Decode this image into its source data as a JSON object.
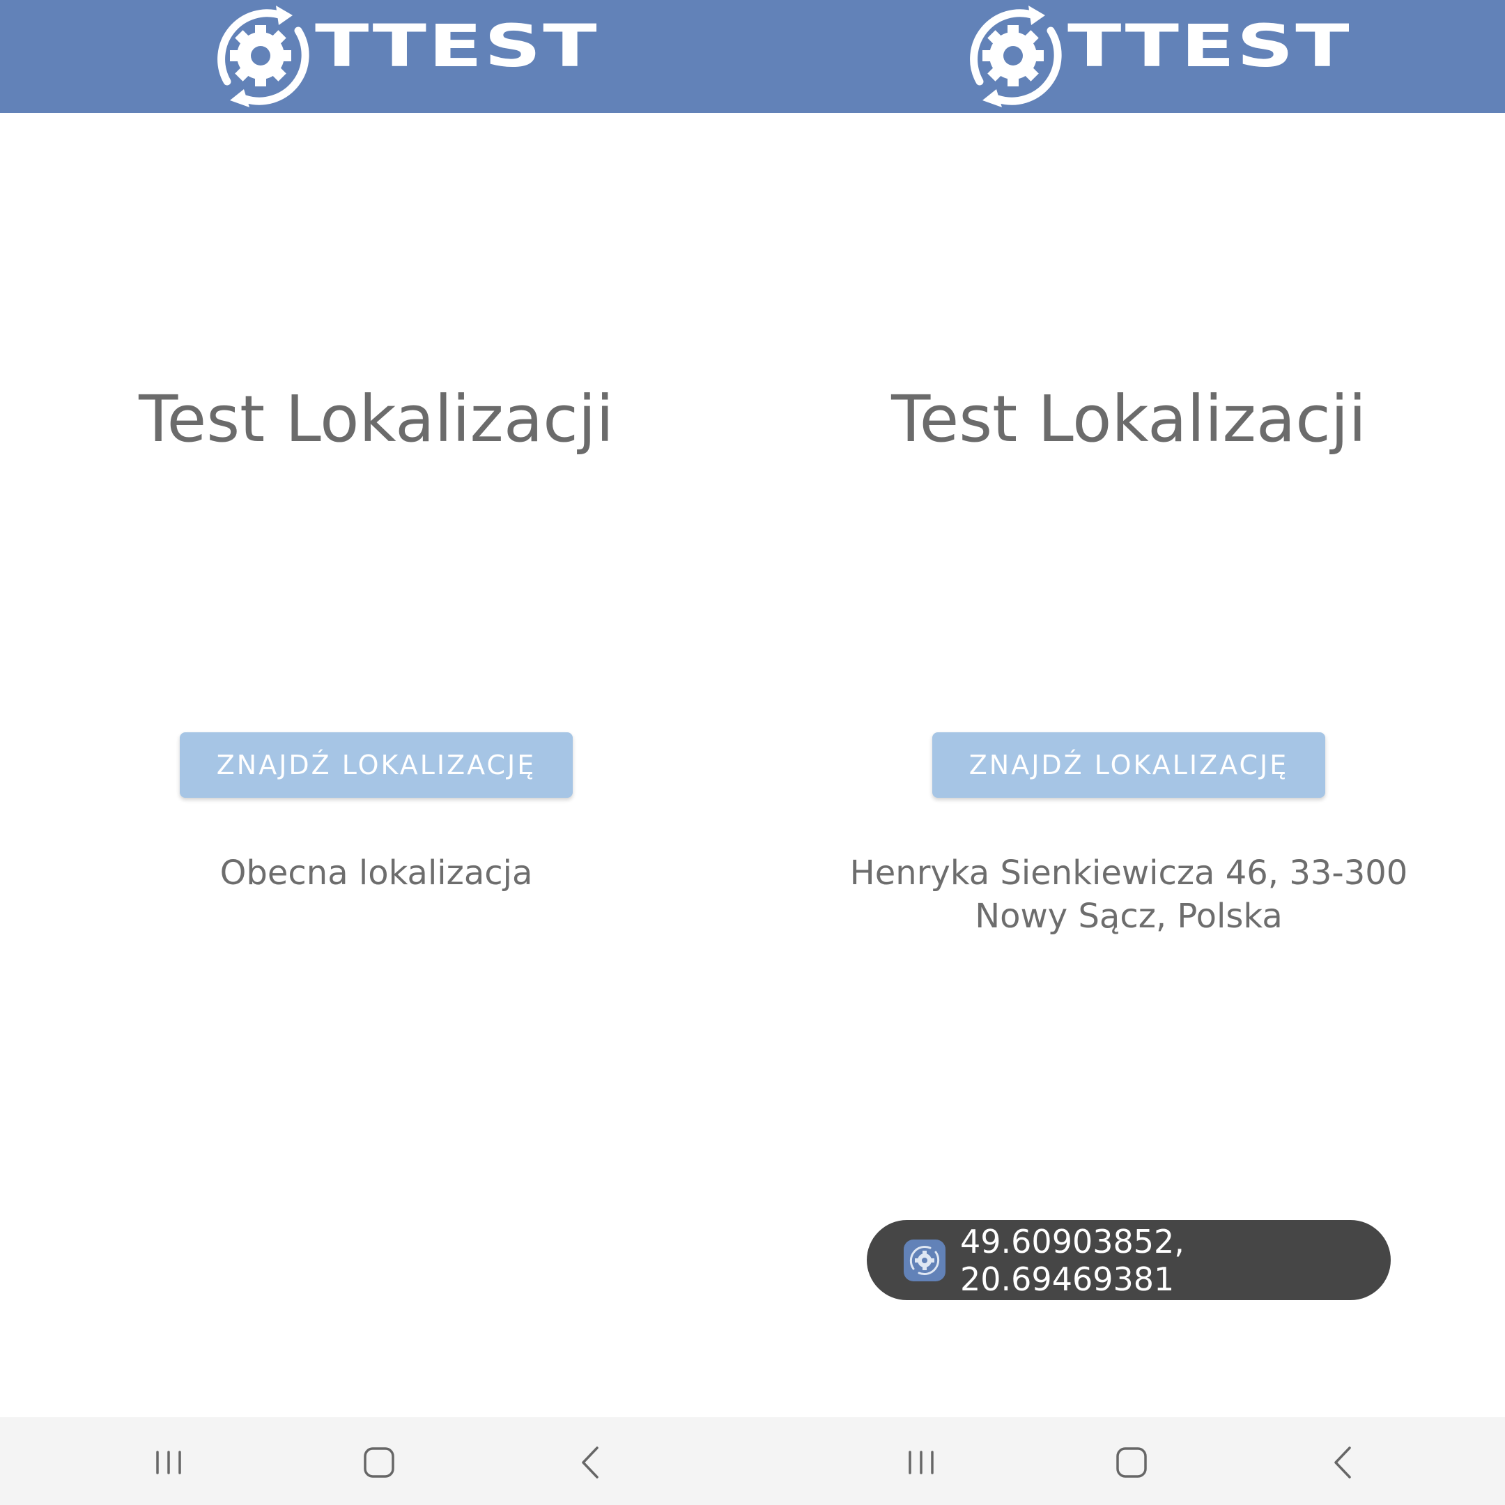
{
  "screens": [
    {
      "brand": {
        "logo_text": "TTEST",
        "icon": "gear-cycle-icon"
      },
      "title": "Test Lokalizacji",
      "find_button_label": "ZNAJDŹ LOKALIZACJĘ",
      "location_lines": [
        "Obecna lokalizacja"
      ],
      "navbar": {
        "recents": "recents-icon",
        "home": "home-icon",
        "back": "back-icon"
      }
    },
    {
      "brand": {
        "logo_text": "TTEST",
        "icon": "gear-cycle-icon"
      },
      "title": "Test Lokalizacji",
      "find_button_label": "ZNAJDŹ LOKALIZACJĘ",
      "location_lines": [
        "Henryka Sienkiewicza 46, 33-300",
        "Nowy Sącz, Polska"
      ],
      "toast": {
        "icon": "app-icon",
        "text": "49.60903852, 20.69469381"
      },
      "navbar": {
        "recents": "recents-icon",
        "home": "home-icon",
        "back": "back-icon"
      }
    }
  ],
  "colors": {
    "appbar": "#6282b8",
    "button": "#a6c5e5",
    "text": "#6b6b6b",
    "toast": "#464646",
    "navbar": "#f4f4f4"
  }
}
